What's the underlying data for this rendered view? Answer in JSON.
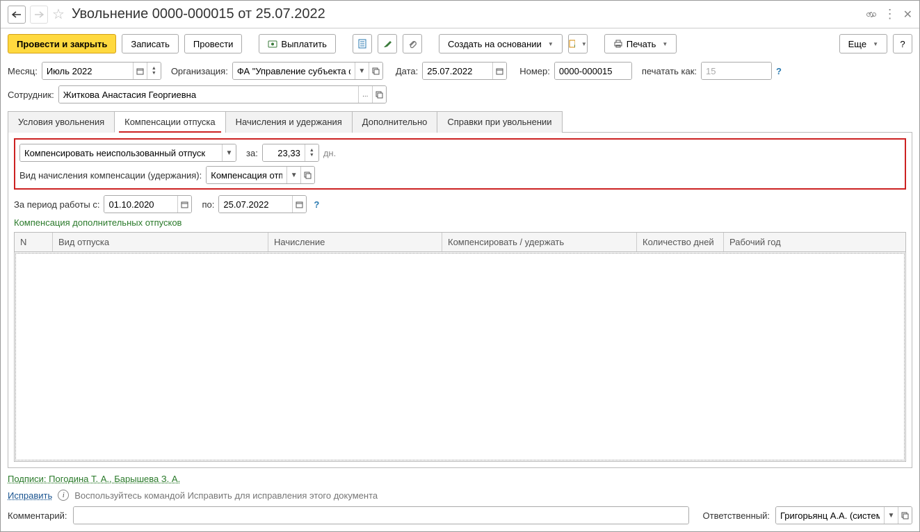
{
  "title": "Увольнение 0000-000015 от 25.07.2022",
  "toolbar": {
    "post_close": "Провести и закрыть",
    "save": "Записать",
    "post": "Провести",
    "pay": "Выплатить",
    "create_based": "Создать на основании",
    "print": "Печать",
    "more": "Еще",
    "help": "?"
  },
  "fields": {
    "month_label": "Месяц:",
    "month_value": "Июль 2022",
    "org_label": "Организация:",
    "org_value": "ФА \"Управление субъекта фе",
    "date_label": "Дата:",
    "date_value": "25.07.2022",
    "number_label": "Номер:",
    "number_value": "0000-000015",
    "print_as_label": "печатать как:",
    "print_as_value": "15",
    "employee_label": "Сотрудник:",
    "employee_value": "Житкова Анастасия Георгиевна"
  },
  "tabs": {
    "t1": "Условия увольнения",
    "t2": "Компенсации отпуска",
    "t3": "Начисления и удержания",
    "t4": "Дополнительно",
    "t5": "Справки при увольнении"
  },
  "comp": {
    "compensate_dropdown": "Компенсировать неиспользованный отпуск",
    "for_label": "за:",
    "days_value": "23,33",
    "days_unit": "дн.",
    "calc_type_label": "Вид начисления компенсации (удержания):",
    "calc_type_value": "Компенсация отпус",
    "period_label": "За период работы с:",
    "period_from": "01.10.2020",
    "period_to_label": "по:",
    "period_to": "25.07.2022",
    "extra_comp_link": "Компенсация дополнительных отпусков"
  },
  "table": {
    "col_n": "N",
    "col_type": "Вид отпуска",
    "col_calc": "Начисление",
    "col_comp": "Компенсировать / удержать",
    "col_days": "Количество дней",
    "col_year": "Рабочий год"
  },
  "signatures": "Подписи: Погодина Т. А., Барышева З. А.",
  "fix_link": "Исправить",
  "fix_hint": "Воспользуйтесь командой Исправить для исправления этого документа",
  "comment_label": "Комментарий:",
  "responsible_label": "Ответственный:",
  "responsible_value": "Григорьянц А.А. (системн"
}
